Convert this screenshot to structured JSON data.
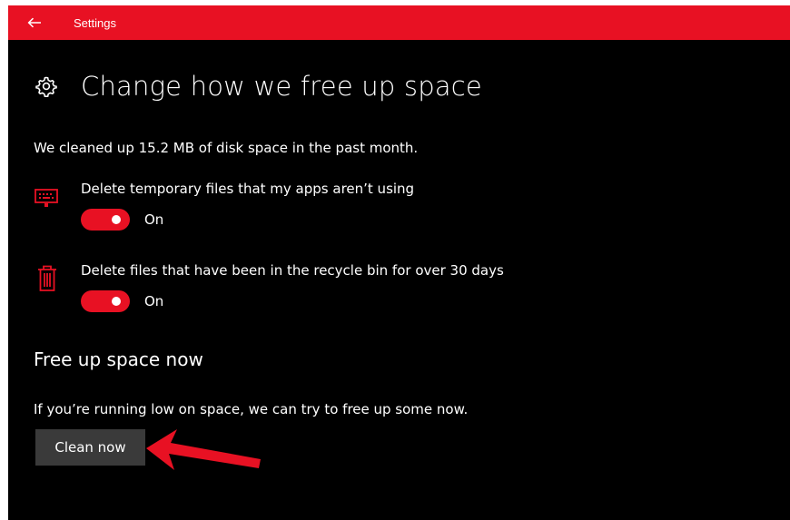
{
  "titlebar": {
    "title": "Settings",
    "back_icon": "back-arrow-icon",
    "color": "#e81123"
  },
  "header": {
    "icon": "gear-icon",
    "title": "Change how we free up space"
  },
  "summary": "We cleaned up 15.2 MB of disk space in the past month.",
  "options": [
    {
      "icon": "keyboard-icon",
      "label": "Delete temporary files that my apps aren’t using",
      "toggle_state": "On",
      "enabled": true
    },
    {
      "icon": "trash-icon",
      "label": "Delete files that have been in the recycle bin for over 30 days",
      "toggle_state": "On",
      "enabled": true
    }
  ],
  "free_up": {
    "heading": "Free up space now",
    "description": "If you’re running low on space, we can try to free up some now.",
    "button_label": "Clean now"
  },
  "annotation": {
    "icon": "red-arrow-icon",
    "color": "#e81123"
  },
  "colors": {
    "accent": "#e81123",
    "background": "#000000",
    "button": "#3a3a3a",
    "text": "#ffffff"
  }
}
